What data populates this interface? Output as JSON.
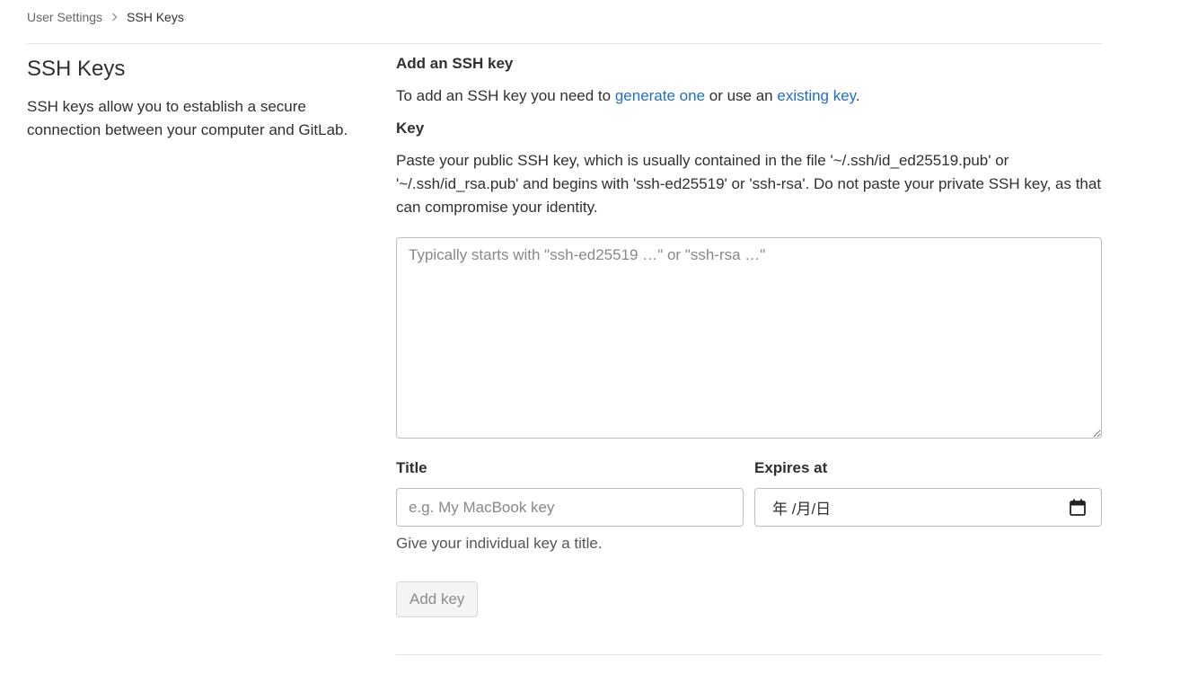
{
  "breadcrumb": {
    "parent": "User Settings",
    "current": "SSH Keys"
  },
  "left": {
    "title": "SSH Keys",
    "description": "SSH keys allow you to establish a secure connection between your computer and GitLab."
  },
  "form": {
    "heading": "Add an SSH key",
    "intro_before": "To add an SSH key you need to ",
    "link_generate": "generate one",
    "intro_middle": " or use an ",
    "link_existing": "existing key",
    "intro_after": ".",
    "key_label": "Key",
    "key_help": "Paste your public SSH key, which is usually contained in the file '~/.ssh/id_ed25519.pub' or '~/.ssh/id_rsa.pub' and begins with 'ssh-ed25519' or 'ssh-rsa'. Do not paste your private SSH key, as that can compromise your identity.",
    "key_placeholder": "Typically starts with \"ssh-ed25519 …\" or \"ssh-rsa …\"",
    "key_value": "",
    "title_label": "Title",
    "title_placeholder": "e.g. My MacBook key",
    "title_value": "",
    "title_help": "Give your individual key a title.",
    "expires_label": "Expires at",
    "expires_display": "年 /月/日",
    "submit_label": "Add key",
    "submit_disabled": true
  },
  "icons": {
    "breadcrumb_separator": "chevron-right-icon",
    "date_picker": "calendar-icon"
  },
  "colors": {
    "link": "#1f6fc5"
  }
}
